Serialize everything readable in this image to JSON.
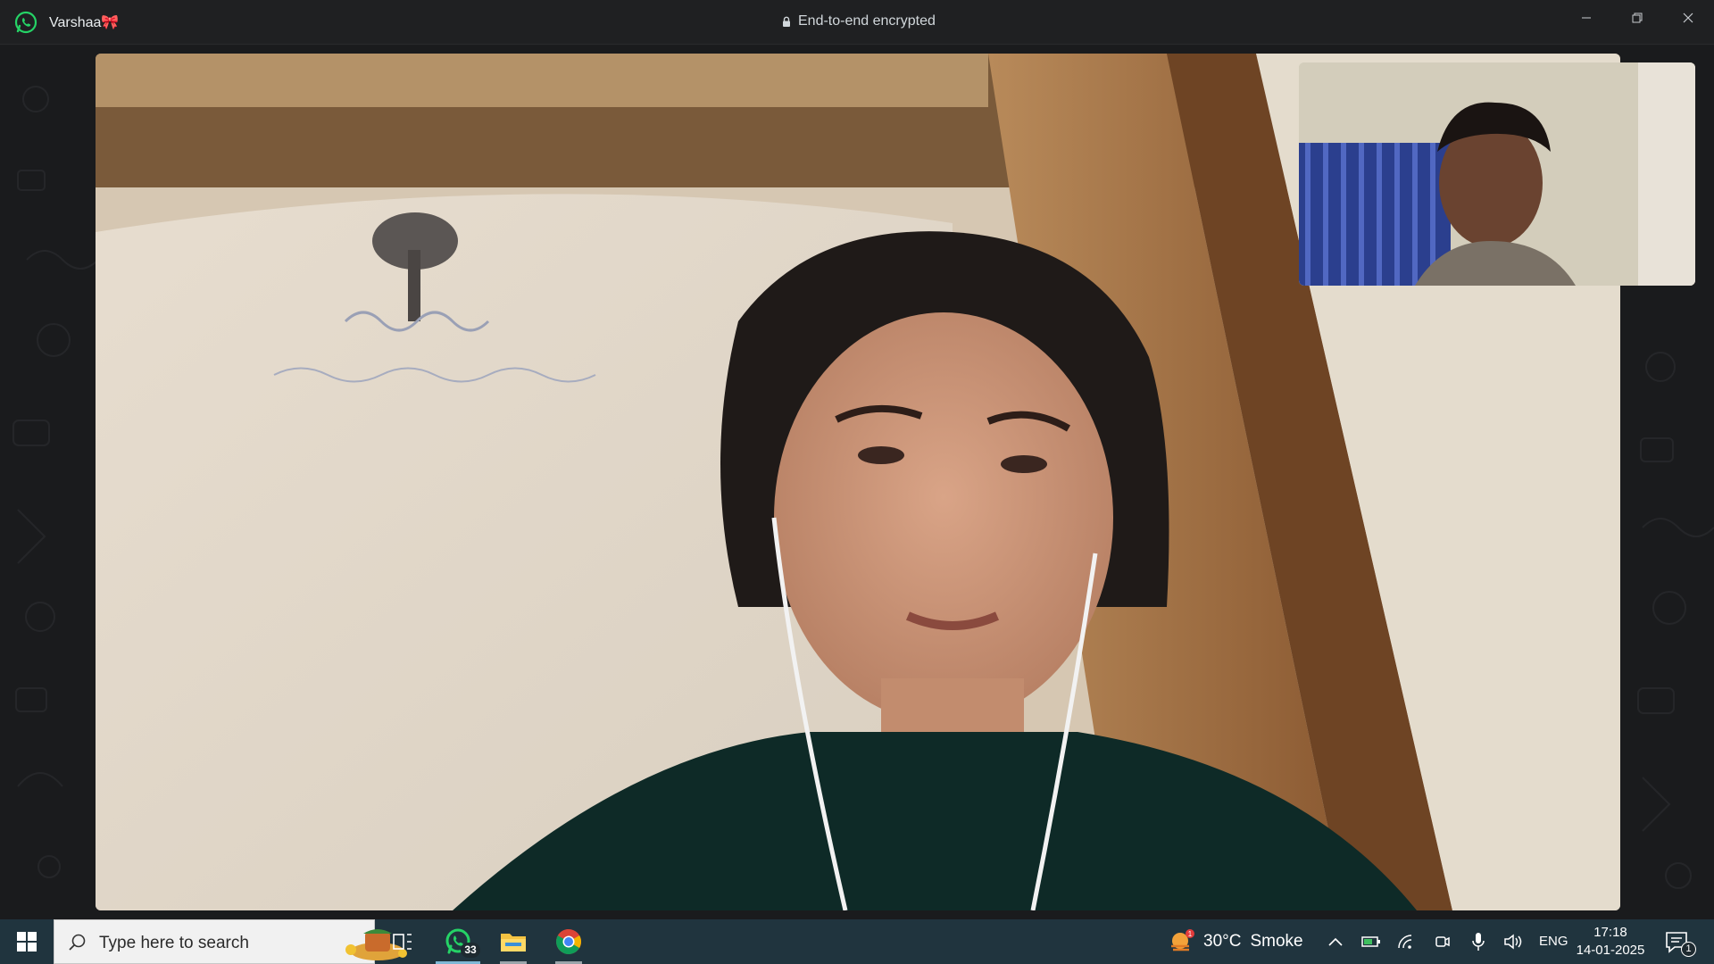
{
  "window": {
    "contact_name": "Varshaa🎀",
    "encryption_status": "End-to-end encrypted",
    "controls": [
      "minimize-icon",
      "restore-icon",
      "close-icon"
    ]
  },
  "call": {
    "main_video": "remote participant video",
    "self_view": "local camera preview"
  },
  "taskbar": {
    "search_placeholder": "Type here to search",
    "apps": [
      {
        "name": "task-view-icon"
      },
      {
        "name": "whatsapp-icon",
        "badge": "33"
      },
      {
        "name": "file-explorer-icon"
      },
      {
        "name": "chrome-icon"
      }
    ],
    "weather": {
      "temp": "30°C",
      "condition": "Smoke",
      "alert_count": "1"
    },
    "language": "ENG",
    "time": "17:18",
    "date": "14-01-2025",
    "notification_count": "1"
  },
  "colors": {
    "titlebar": "#1f2022",
    "taskbar": "#20343e",
    "whatsapp_green": "#25d366"
  }
}
